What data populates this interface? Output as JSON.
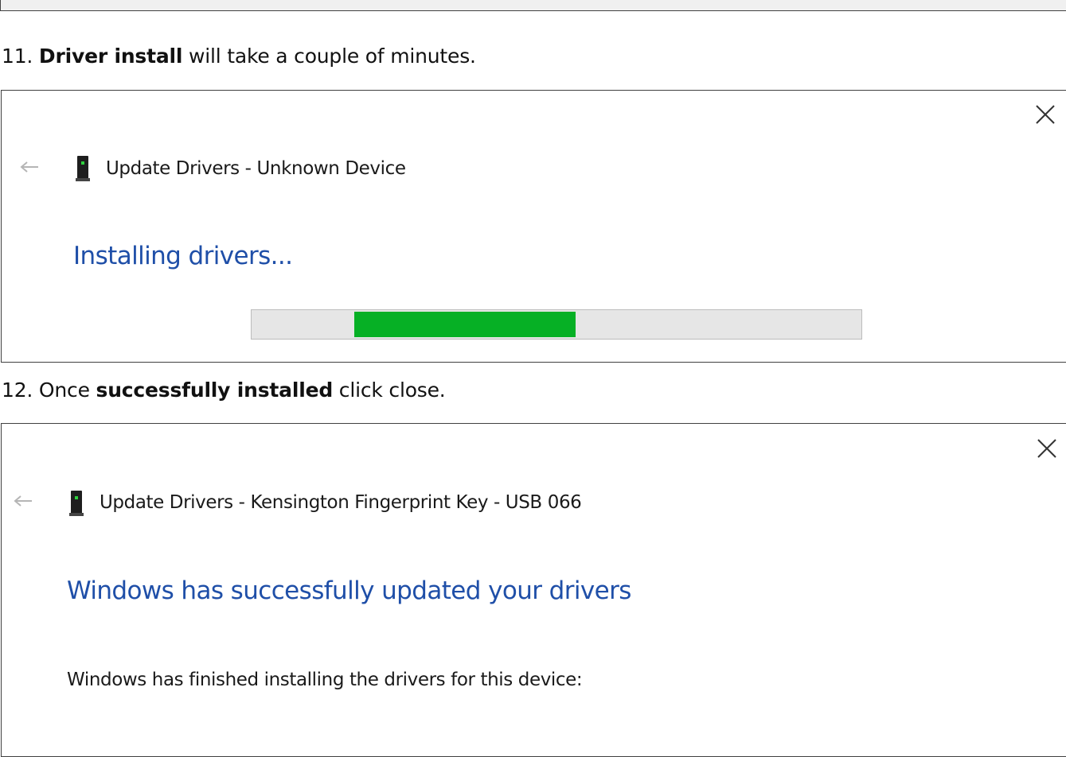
{
  "step_11": {
    "number": "11.",
    "bold": "Driver install",
    "rest": "will take a couple of minutes."
  },
  "dialog_installing": {
    "title": "Update Drivers - Unknown Device",
    "heading": "Installing drivers...",
    "progress": {
      "fill_start_fraction": 0.168,
      "fill_end_fraction": 0.531,
      "color": "#06b025"
    },
    "icons": {
      "close": "close-icon",
      "back": "back-arrow-icon",
      "device": "device-icon"
    }
  },
  "step_12": {
    "number": "12.",
    "prefix": "Once",
    "bold": "successfully installed",
    "rest": "click close."
  },
  "dialog_success": {
    "title": "Update Drivers - Kensington Fingerprint Key - USB 066",
    "heading": "Windows has successfully updated your drivers",
    "body": "Windows has finished installing the drivers for this device:",
    "icons": {
      "close": "close-icon",
      "back": "back-arrow-icon",
      "device": "device-icon"
    }
  },
  "colors": {
    "heading_blue": "#1f4fa8",
    "progress_green": "#06b025"
  }
}
